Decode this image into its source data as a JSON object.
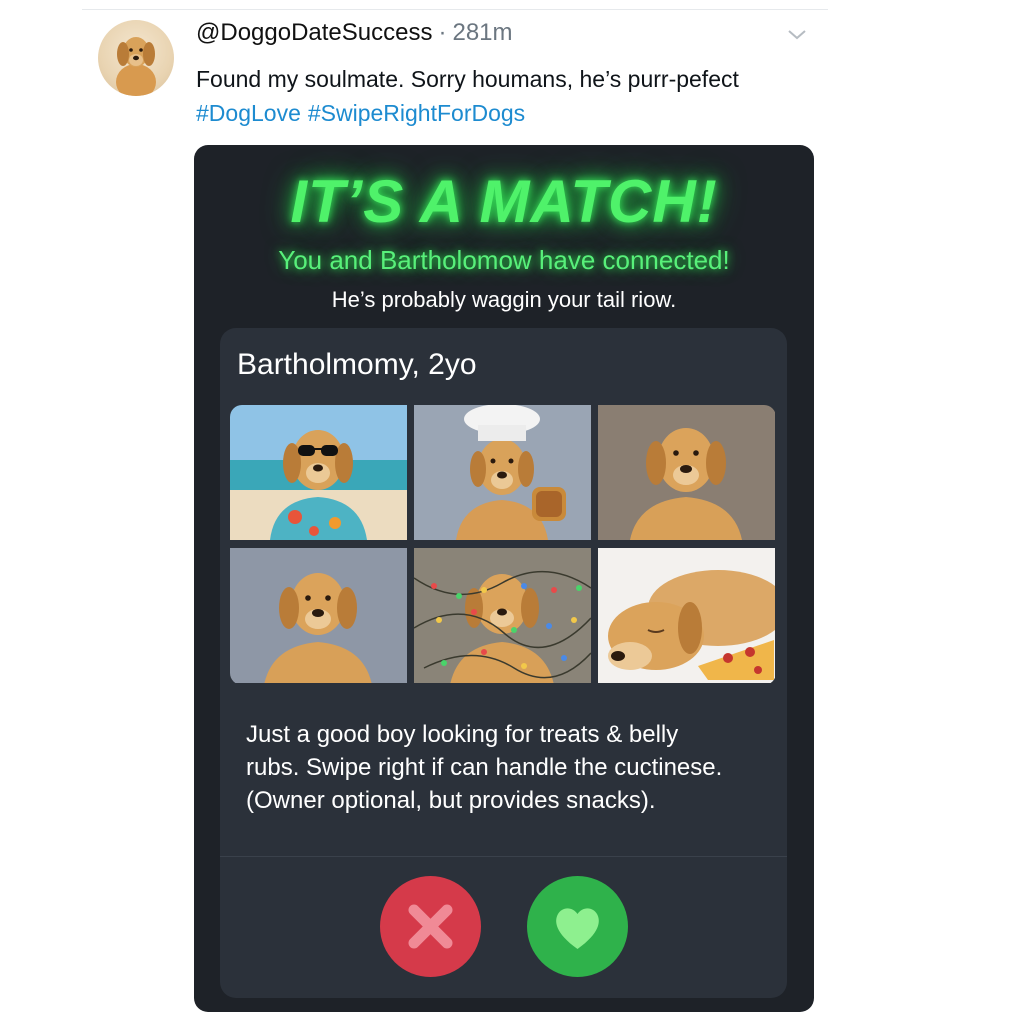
{
  "tweet": {
    "handle": "@DoggoDateSuccess",
    "separator": "·",
    "time": "281m",
    "text": "Found my soulmate. Sorry houmans, he’s purr-pefect",
    "hashtags": [
      "#DogLove",
      "#SwipeRightForDogs"
    ],
    "avatar_icon": "golden-retriever-avatar",
    "menu_icon": "chevron-down-icon"
  },
  "match": {
    "title": "IT’S A MATCH!",
    "subtitle": "You and Bartholomow have connected!",
    "note": "He’s probably waggin your tail riow."
  },
  "profile": {
    "name": "Bartholmomy, 2yo",
    "photos": [
      "dog-sunglasses-beach-photo",
      "dog-chef-hat-toast-photo",
      "dog-portrait-photo",
      "dog-portrait-grey-photo",
      "dog-fairy-lights-photo",
      "dog-sleeping-pizza-photo"
    ],
    "bio_lines": [
      "Just a good boy looking for treats & belly",
      "rubs. Swipe right if can handle the cuctinese.",
      "(Owner optional, but provides snacks)."
    ]
  },
  "actions": {
    "reject_icon": "close-icon",
    "like_icon": "heart-icon"
  },
  "colors": {
    "link": "#1d8bd0",
    "card_bg": "#1e2228",
    "panel_bg": "#2b313a",
    "neon_green": "#4ff26a",
    "reject": "#d53a4a",
    "like": "#2fb24b"
  }
}
